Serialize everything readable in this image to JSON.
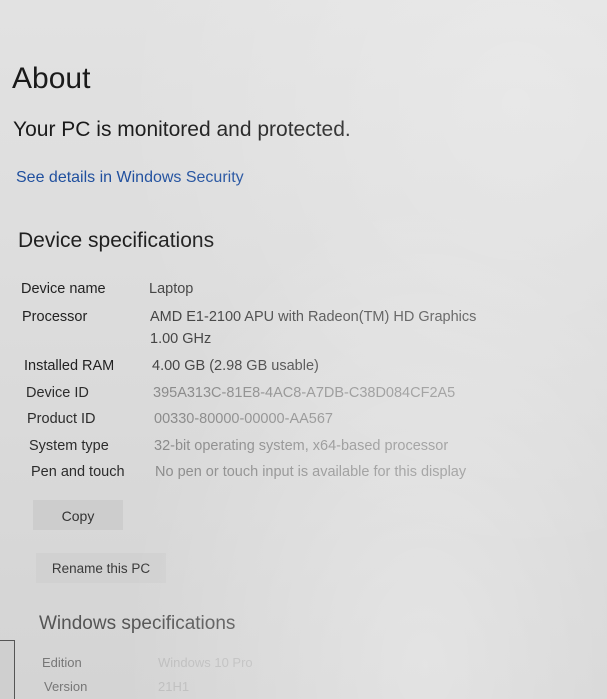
{
  "page": {
    "title": "About",
    "protection_status": "Your PC is monitored and protected.",
    "security_link": "See details in Windows Security"
  },
  "device_specs": {
    "section_title": "Device specifications",
    "rows": [
      {
        "key": "Device name",
        "value": "Laptop"
      },
      {
        "key": "Processor",
        "value": "AMD E1-2100 APU with Radeon(TM) HD Graphics",
        "value2": "1.00 GHz"
      },
      {
        "key": "Installed RAM",
        "value": "4.00 GB (2.98 GB usable)"
      },
      {
        "key": "Device ID",
        "value": "395A313C-81E8-4AC8-A7DB-C38D084CF2A5"
      },
      {
        "key": "Product ID",
        "value": "00330-80000-00000-AA567"
      },
      {
        "key": "System type",
        "value": "32-bit operating system, x64-based processor"
      },
      {
        "key": "Pen and touch",
        "value": "No pen or touch input is available for this display"
      }
    ],
    "copy_label": "Copy",
    "rename_label": "Rename this PC"
  },
  "windows_specs": {
    "section_title": "Windows specifications",
    "rows": [
      {
        "key": "Edition",
        "value": "Windows 10 Pro"
      },
      {
        "key": "Version",
        "value": "21H1"
      }
    ]
  }
}
